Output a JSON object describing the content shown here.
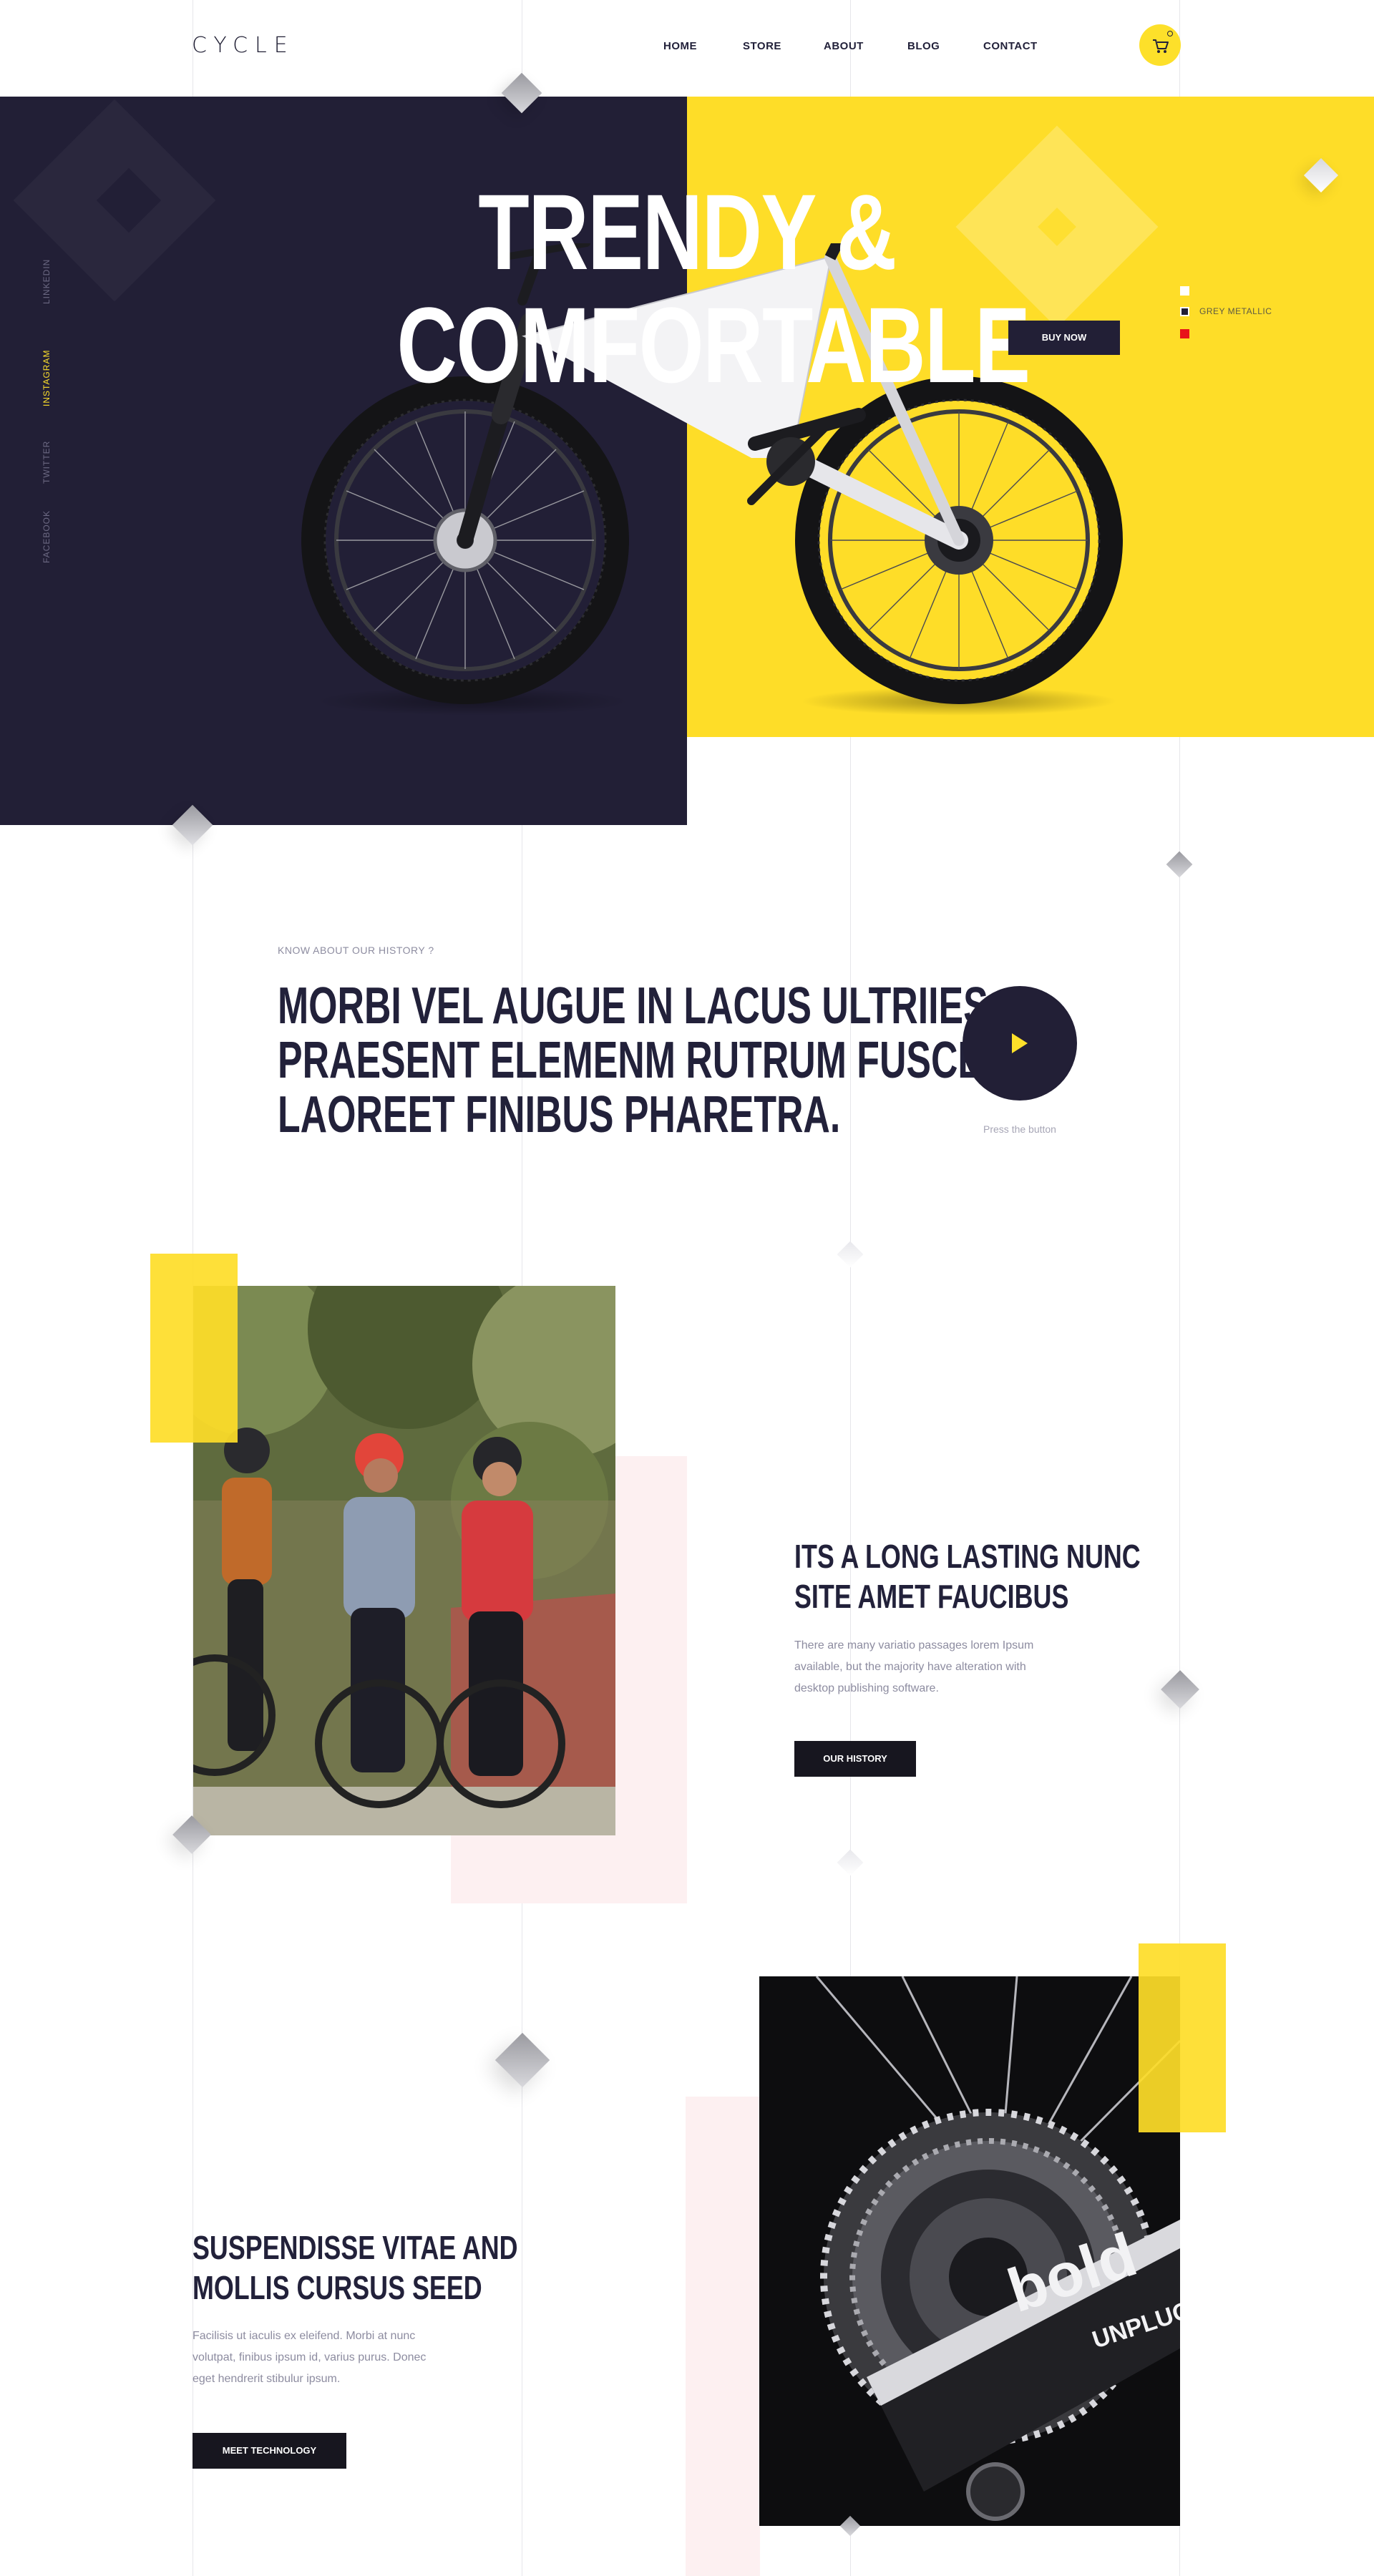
{
  "header": {
    "logo": "CYCLE",
    "nav": [
      "HOME",
      "STORE",
      "ABOUT",
      "BLOG",
      "CONTACT"
    ],
    "cart_icon": "cart-icon"
  },
  "hero": {
    "title_line1": "TRENDY &",
    "title_line2": "COMFORTABLE",
    "buy_label": "BUY NOW",
    "social": [
      "LINKEDIN",
      "INSTAGRAM",
      "TWITTER",
      "FACEBOOK"
    ],
    "active_social": "INSTAGRAM",
    "color_options": [
      "#ffffff",
      "#221f36",
      "#e8121a"
    ],
    "selected_color_label": "GREY METALLIC",
    "colors": {
      "dark": "#221f36",
      "yellow": "#fedd28",
      "accent_red": "#e8121a"
    }
  },
  "intro": {
    "eyebrow": "KNOW ABOUT OUR HISTORY ?",
    "headline_lines": [
      "MORBI VEL AUGUE IN LACUS ULTRIIES",
      "PRAESENT ELEMENM RUTRUM FUSCE",
      "LAOREET FINIBUS PHARETRA."
    ],
    "press_label": "Press the button"
  },
  "history": {
    "title_lines": [
      "ITS A LONG LASTING  NUNC",
      "SITE AMET FAUCIBUS"
    ],
    "text_lines": [
      "There are many variatio passages lorem Ipsum",
      "available, but the majority have alteration with",
      "desktop publishing software."
    ],
    "button": "OUR HISTORY"
  },
  "technology": {
    "title_lines": [
      "SUSPENDISSE VITAE AND",
      "MOLLIS CURSUS SEED"
    ],
    "text_lines": [
      "Facilisis ut iaculis ex eleifend. Morbi at nunc",
      "volutpat, finibus ipsum id, varius purus. Donec",
      "eget hendrerit stibulur ipsum."
    ],
    "button": "MEET TECHNOLOGY",
    "photo_brand": "bold",
    "photo_brand_sub": "UNPLUGGED"
  }
}
